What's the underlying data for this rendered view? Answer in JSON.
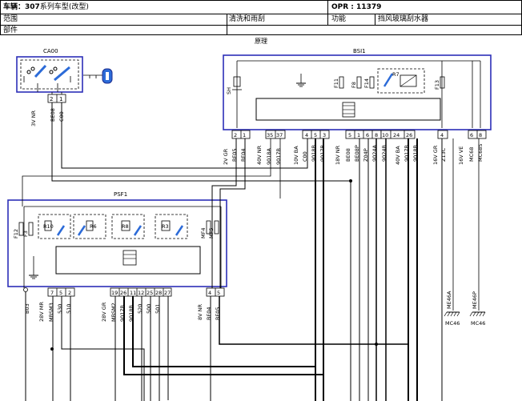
{
  "header": {
    "vehicle_label": "车辆：",
    "vehicle_model": "307",
    "vehicle_suffix": "系列车型(改型)",
    "opr_label": "OPR : ",
    "opr_value": "11379",
    "scope_label": "范围",
    "scope_value": "清洗和雨刮",
    "function_label": "功能",
    "function_value": "挡风玻璃刮水器",
    "part_label": "部件"
  },
  "diagram": {
    "title": "原理",
    "modules": {
      "ca00": "CA00",
      "bsi1": "BSI1",
      "psf1": "PSF1"
    },
    "ca00_conn": {
      "pins": [
        "2",
        "1"
      ],
      "wires": [
        "BE08",
        "C00"
      ],
      "connector": "3V NR"
    },
    "bsi_internal": {
      "sh": "SH",
      "f11": "F11",
      "f8": "F8",
      "f14": "F14",
      "r7": "R7",
      "f13": "F13"
    },
    "bsi_conns": [
      {
        "name": "2V GR",
        "pins": [
          "2",
          "1"
        ],
        "wires": [
          "BF05",
          "BF04"
        ]
      },
      {
        "name": "40V NR",
        "pins": [
          "35",
          "37"
        ],
        "wires": [
          "9018A",
          "9017B"
        ]
      },
      {
        "name": "10V BA",
        "pins": [
          "4",
          "5",
          "3"
        ],
        "wires": [
          "C00",
          "9018B",
          "9017B"
        ]
      },
      {
        "name": "18V NR",
        "pins": [
          "5",
          "1",
          "6",
          "8"
        ],
        "wires": [
          "BE08",
          "BE08P",
          "Z04P",
          "9024A"
        ]
      },
      {
        "name": "40V BA",
        "pins": [
          "10",
          "24",
          "26"
        ],
        "wires": [
          "9024B",
          "9017B",
          "9018B"
        ]
      },
      {
        "name": "16V GR",
        "pins": [
          "4"
        ],
        "wires": [
          "Z13C"
        ]
      },
      {
        "name": "16V VE",
        "pins": [
          "6",
          "8"
        ],
        "wires": [
          "MC68",
          "MC68S"
        ]
      }
    ],
    "psf_internal": {
      "f12": "F12",
      "f3": "F3",
      "r10": "R10",
      "r6": "R6",
      "r8": "R8",
      "r3": "R3",
      "mf4": "MF4",
      "mf5": "MF5"
    },
    "psf_conns": [
      {
        "name": "28V MR",
        "pins": [
          "7",
          "5",
          "2"
        ],
        "wires": [
          "MBSM3",
          "530",
          "510"
        ]
      },
      {
        "name": "28V GR",
        "pins": [
          "19",
          "26",
          "11",
          "12",
          "25",
          "28",
          "27"
        ],
        "wires": [
          "MBSM2",
          "9017B",
          "9018B",
          "520",
          "500",
          "501"
        ]
      },
      {
        "name": "8V NR",
        "pins": [
          "4",
          "5"
        ],
        "wires": [
          "BF04",
          "BF05"
        ]
      }
    ],
    "b03": "B03",
    "grounds": [
      {
        "wire": "ME46A",
        "label": "MC46"
      },
      {
        "wire": "ME46P",
        "label": "MC46"
      }
    ]
  }
}
